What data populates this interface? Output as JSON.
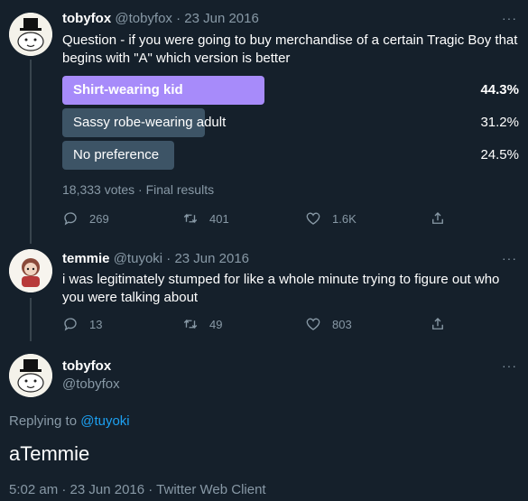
{
  "tweet1": {
    "name": "tobyfox",
    "handle_date": "@tobyfox · 23 Jun 2016",
    "text_line1": "Question - if you were going to buy merchandise of a certain Tragic Boy that",
    "text_line2": "begins with \"A\" which version is better",
    "poll": {
      "options": [
        {
          "label": "Shirt-wearing kid",
          "percent": "44.3%",
          "fraction": 0.443,
          "winner": true
        },
        {
          "label": "Sassy robe-wearing adult",
          "percent": "31.2%",
          "fraction": 0.312,
          "winner": false
        },
        {
          "label": "No preference",
          "percent": "24.5%",
          "fraction": 0.245,
          "winner": false
        }
      ],
      "summary": "18,333 votes · Final results"
    },
    "replies": "269",
    "retweets": "401",
    "likes": "1.6K",
    "more": "···"
  },
  "tweet2": {
    "name": "temmie",
    "handle_date": "@tuyoki · 23 Jun 2016",
    "text_line1": "i was legitimately stumped for like a whole minute trying to figure out who",
    "text_line2": "you were talking about",
    "replies": "13",
    "retweets": "49",
    "likes": "803",
    "more": "···"
  },
  "main_tweet": {
    "name": "tobyfox",
    "handle": "@tobyfox",
    "replying_prefix": "Replying to ",
    "replying_handle": "@tuyoki",
    "text": "aTemmie",
    "timestamp": "5:02 am · 23 Jun 2016 · Twitter Web Client",
    "more": "···"
  },
  "colors": {
    "background": "#15202b",
    "poll_winner": "#a78bfa",
    "poll_other": "#3d5466",
    "muted": "#8899a6",
    "link": "#1da1f2"
  }
}
